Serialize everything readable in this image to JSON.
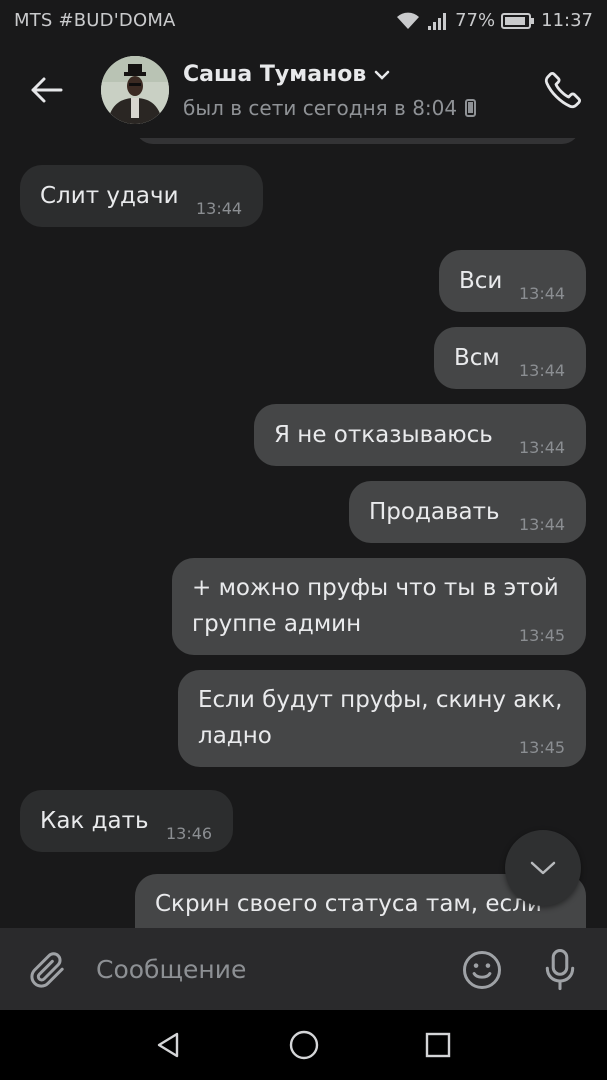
{
  "status_bar": {
    "carrier": "MTS #BUD'DOMA",
    "battery": "77%",
    "time": "11:37"
  },
  "header": {
    "contact_name": "Саша Туманов",
    "last_seen": "был в сети сегодня в 8:04"
  },
  "messages": [
    {
      "side": "in",
      "lines": [
        "Слит удачи"
      ],
      "time": "13:44"
    },
    {
      "side": "out",
      "lines": [
        "Вси"
      ],
      "time": "13:44"
    },
    {
      "side": "out",
      "lines": [
        "Всм"
      ],
      "time": "13:44"
    },
    {
      "side": "out",
      "lines": [
        "Я не отказываюсь"
      ],
      "time": "13:44"
    },
    {
      "side": "out",
      "lines": [
        "Продавать"
      ],
      "time": "13:44"
    },
    {
      "side": "out",
      "lines": [
        "+ можно пруфы что ты в этой",
        "группе админ"
      ],
      "time": "13:45"
    },
    {
      "side": "out",
      "lines": [
        "Если будут пруфы, скину акк,",
        "ладно"
      ],
      "time": "13:45"
    },
    {
      "side": "in",
      "lines": [
        "Как дать"
      ],
      "time": "13:46"
    },
    {
      "side": "out",
      "lines": [
        "Скрин своего статуса там, если"
      ],
      "time": ""
    }
  ],
  "composer": {
    "placeholder": "Сообщение"
  },
  "colors": {
    "background": "#19191a",
    "bubble_in": "#2c2d2e",
    "bubble_out": "#454647",
    "composer": "#2a2a2c"
  },
  "icons": {
    "back": "arrow-left-icon",
    "dropdown": "chevron-down-icon",
    "device": "phone-device-icon",
    "call": "phone-call-icon",
    "scroll_down": "chevron-down-icon",
    "attach": "paperclip-icon",
    "emoji": "smiley-icon",
    "mic": "microphone-icon",
    "nav_back": "triangle-back-icon",
    "nav_home": "circle-home-icon",
    "nav_recents": "square-recents-icon"
  }
}
